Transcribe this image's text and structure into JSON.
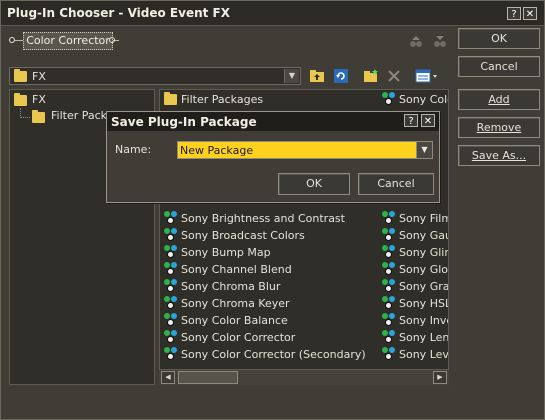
{
  "window": {
    "title": "Plug-In Chooser - Video Event FX",
    "help_glyph": "?",
    "close_glyph": "✕"
  },
  "chain": {
    "selected_effect": "Color Corrector"
  },
  "sidebar_buttons": {
    "ok": "OK",
    "cancel": "Cancel",
    "add": "Add",
    "remove": "Remove",
    "save_as": "Save As..."
  },
  "path": {
    "value": "FX"
  },
  "tree": {
    "root": "FX",
    "child": "Filter Packa"
  },
  "list": {
    "left_column": [
      "Filter Packages",
      "Sony Brightness and Contrast",
      "Sony Broadcast Colors",
      "Sony Bump Map",
      "Sony Channel Blend",
      "Sony Chroma Blur",
      "Sony Chroma Keyer",
      "Sony Color Balance",
      "Sony Color Corrector",
      "Sony Color Corrector (Secondary)"
    ],
    "right_column": [
      "Sony Colo",
      "Sony Film",
      "Sony Gaus",
      "Sony Glint",
      "Sony Glow",
      "Sony Grad",
      "Sony HSL",
      "Sony Inve",
      "Sony Lens",
      "Sony Leve"
    ]
  },
  "dialog": {
    "title": "Save Plug-In Package",
    "name_label": "Name:",
    "name_value": "New Package",
    "ok": "OK",
    "cancel": "Cancel",
    "help_glyph": "?",
    "close_glyph": "✕"
  },
  "colors": {
    "window_bg": "#3f3d36",
    "titlebar_bg": "#2b2a25",
    "field_highlight": "#ffd21f",
    "folder": "#e9c64d",
    "fx_green": "#2fb24a",
    "fx_blue": "#26a6d9"
  },
  "icons": {
    "folder": "folder-icon",
    "fx": "fx-plugin-icon",
    "up_folder": "up-folder-icon",
    "refresh": "refresh-icon",
    "new_folder": "new-folder-icon",
    "delete": "delete-icon",
    "view": "view-options-icon"
  }
}
